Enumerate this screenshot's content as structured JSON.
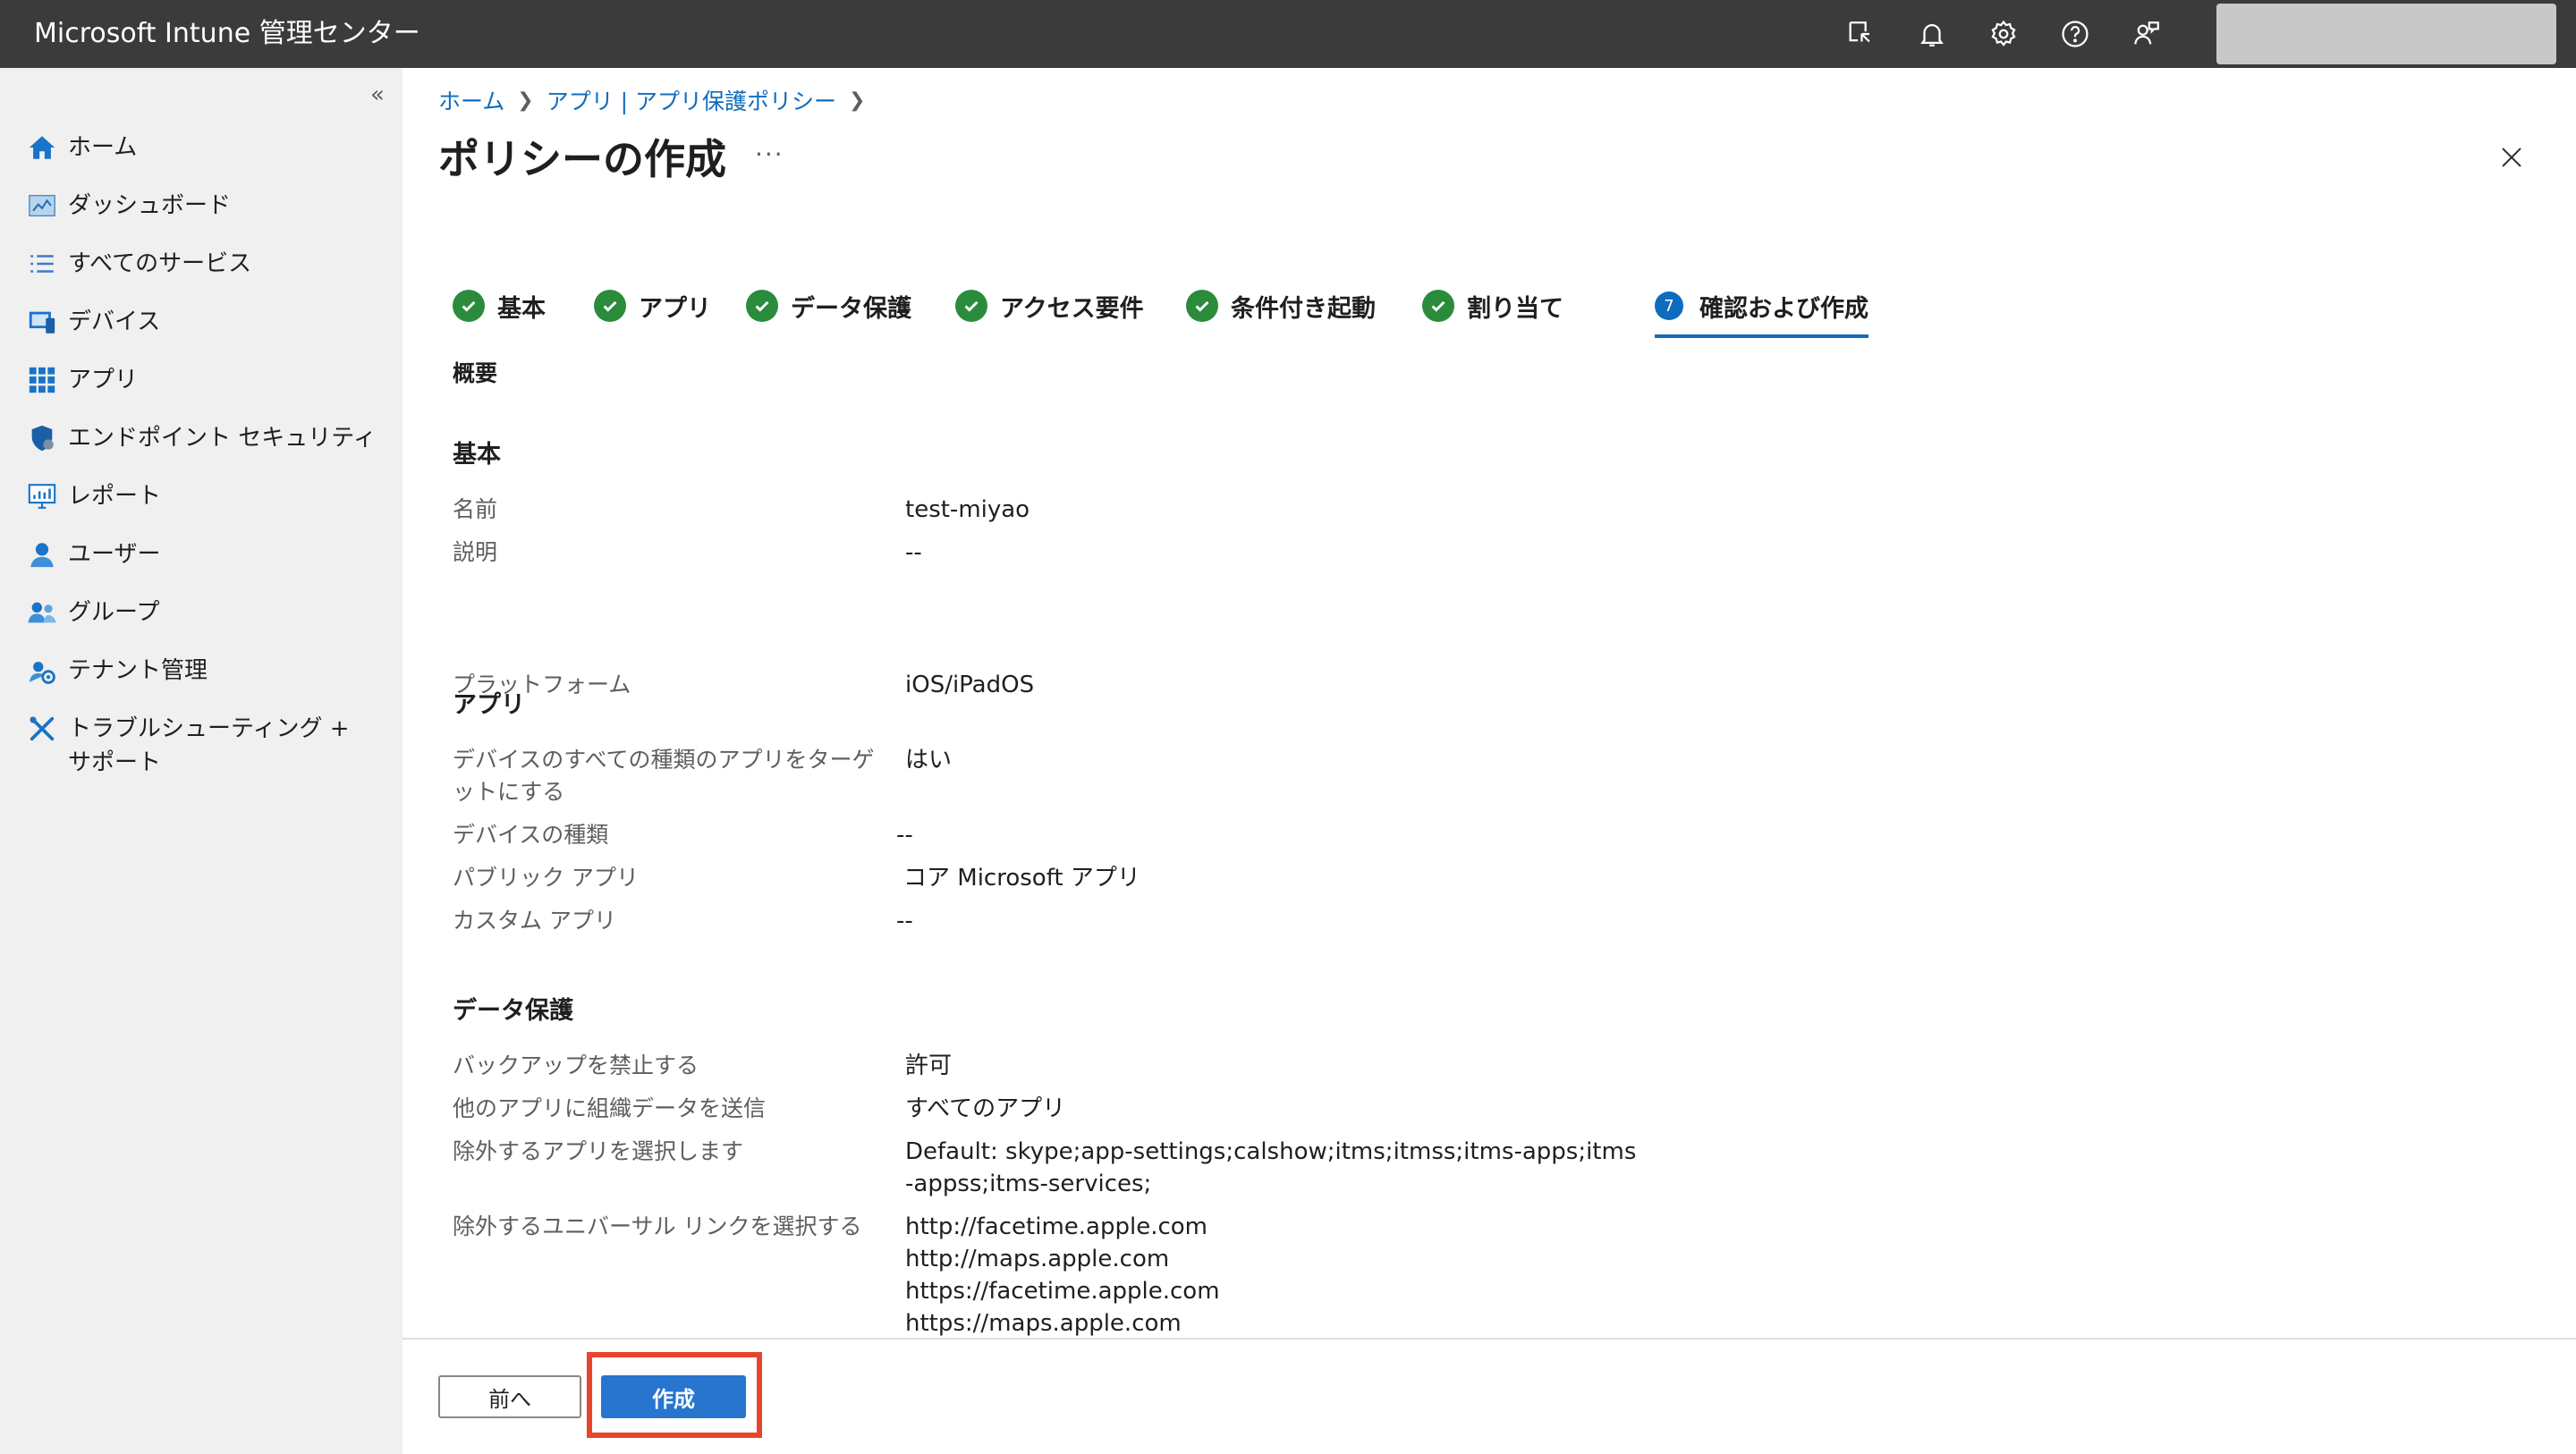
{
  "topbar": {
    "title": "Microsoft Intune 管理センター",
    "icons": [
      "portal-feedback-icon",
      "bell-icon",
      "gear-icon",
      "help-icon",
      "feedback-person-icon"
    ]
  },
  "sidebar": {
    "collapse_glyph": "«",
    "items": [
      {
        "label": "ホーム",
        "icon": "home-icon"
      },
      {
        "label": "ダッシュボード",
        "icon": "dashboard-icon"
      },
      {
        "label": "すべてのサービス",
        "icon": "list-icon"
      },
      {
        "label": "デバイス",
        "icon": "device-icon"
      },
      {
        "label": "アプリ",
        "icon": "apps-grid-icon"
      },
      {
        "label": "エンドポイント セキュリティ",
        "icon": "shield-icon"
      },
      {
        "label": "レポート",
        "icon": "report-icon"
      },
      {
        "label": "ユーザー",
        "icon": "user-icon"
      },
      {
        "label": "グループ",
        "icon": "group-icon"
      },
      {
        "label": "テナント管理",
        "icon": "tenant-icon"
      },
      {
        "label": "トラブルシューティング + サポート",
        "icon": "wrench-icon"
      }
    ]
  },
  "breadcrumb": [
    "ホーム",
    "アプリ | アプリ保護ポリシー"
  ],
  "page": {
    "title": "ポリシーの作成",
    "more": "···"
  },
  "steps": [
    {
      "label": "基本",
      "state": "done"
    },
    {
      "label": "アプリ",
      "state": "done"
    },
    {
      "label": "データ保護",
      "state": "done"
    },
    {
      "label": "アクセス要件",
      "state": "done"
    },
    {
      "label": "条件付き起動",
      "state": "done"
    },
    {
      "label": "割り当て",
      "state": "done"
    },
    {
      "label": "確認および作成",
      "state": "active",
      "number": "7"
    }
  ],
  "summary": {
    "heading": "概要",
    "basics": {
      "title": "基本",
      "rows": [
        {
          "label": "名前",
          "value": "test-miyao"
        },
        {
          "label": "説明",
          "value": "--"
        },
        {
          "label": "プラットフォーム",
          "value": "iOS/iPadOS"
        }
      ]
    },
    "apps": {
      "title": "アプリ",
      "rows": [
        {
          "label": "デバイスのすべての種類のアプリをターゲットにする",
          "value": "はい"
        },
        {
          "label": "デバイスの種類",
          "value": "--"
        },
        {
          "label": "パブリック アプリ",
          "value": "コア Microsoft アプリ"
        },
        {
          "label": "カスタム アプリ",
          "value": "--"
        }
      ]
    },
    "data_protection": {
      "title": "データ保護",
      "rows": [
        {
          "label": "バックアップを禁止する",
          "value": "許可"
        },
        {
          "label": "他のアプリに組織データを送信",
          "value": "すべてのアプリ"
        },
        {
          "label": "除外するアプリを選択します",
          "value": "Default: skype;app-settings;calshow;itms;itmss;itms-apps;itms-appss;itms-services;"
        },
        {
          "label": "除外するユニバーサル リンクを選択する",
          "values": [
            "http://facetime.apple.com",
            "http://maps.apple.com",
            "https://facetime.apple.com",
            "https://maps.apple.com"
          ]
        }
      ]
    }
  },
  "footer": {
    "prev_label": "前へ",
    "create_label": "作成",
    "highlight_color": "#e8452c"
  },
  "colors": {
    "topbar": "#3b3b3b",
    "sidebar": "#f0f0f0",
    "accent": "#0f6cbd",
    "success": "#2a8c3b",
    "primary_button": "#2775cf"
  }
}
